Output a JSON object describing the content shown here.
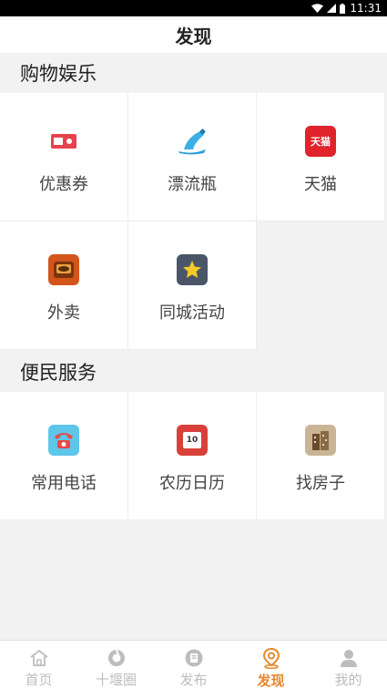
{
  "status_bar": {
    "time": "11:31",
    "icons": [
      "wifi-icon",
      "signal-icon",
      "battery-icon"
    ]
  },
  "header": {
    "title": "发现"
  },
  "sections": [
    {
      "title": "购物娱乐",
      "items": [
        {
          "label": "优惠券",
          "icon": "coupon-icon",
          "color": "#e8424f"
        },
        {
          "label": "漂流瓶",
          "icon": "drift-bottle-icon",
          "color": "#2a9fd8"
        },
        {
          "label": "天猫",
          "icon": "tmall-icon",
          "color": "#e0242c",
          "icon_text": "天猫"
        },
        {
          "label": "外卖",
          "icon": "takeout-icon",
          "color": "#d4551c"
        },
        {
          "label": "同城活动",
          "icon": "star-icon",
          "color": "#4a5668"
        }
      ]
    },
    {
      "title": "便民服务",
      "items": [
        {
          "label": "常用电话",
          "icon": "phone-icon",
          "color": "#e84a4a"
        },
        {
          "label": "农历日历",
          "icon": "calendar-icon",
          "color": "#d8403a",
          "icon_text": "10"
        },
        {
          "label": "找房子",
          "icon": "house-icon",
          "color": "#9a8468"
        }
      ]
    }
  ],
  "tabs": [
    {
      "label": "首页",
      "icon": "home-icon"
    },
    {
      "label": "十堰圈",
      "icon": "circle-icon"
    },
    {
      "label": "发布",
      "icon": "publish-icon"
    },
    {
      "label": "发现",
      "icon": "location-icon",
      "active": true
    },
    {
      "label": "我的",
      "icon": "user-icon"
    }
  ],
  "colors": {
    "accent": "#e8862a",
    "inactive": "#bdbdbd",
    "background": "#f2f2f2"
  }
}
